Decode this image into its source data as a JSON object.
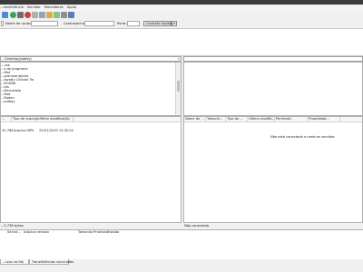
{
  "menu": [
    "...ransferência",
    "Servidor",
    "Marcadores",
    "Ajuda"
  ],
  "toolbar": {
    "icons": [
      "connect-icon",
      "refresh-icon",
      "process-queue-icon",
      "cancel-icon",
      "disconnect-icon",
      "reconnect-icon",
      "filter-icon",
      "compare-icon",
      "sync-browse-icon",
      "search-icon"
    ]
  },
  "quickconnect": {
    "user_label": "Nome de usuário:",
    "password_label": "Contrasenha:",
    "port_label": "Porta:",
    "button_label": "Conexão rápida"
  },
  "local": {
    "path": "...Desktop\\Jadeby\\",
    "tree": [
      "...use",
      "...s de programa",
      "...ftist",
      "...gramaoriginals",
      "...ewotty Cellular Tw",
      "...ROGRA",
      "...tes",
      "...Mercadola",
      "...Red",
      "...Rodan",
      "...Jadeby"
    ],
    "columns": [
      "...",
      "Tipo de arquivo",
      "Última modificação"
    ],
    "files": [
      {
        "size": "32,784",
        "type": "Arquivo MP4",
        "modified": "22/01/2019 13:32:52"
      }
    ],
    "status": "...2,738 bytes"
  },
  "remote": {
    "path": "",
    "columns": [
      "Nome de ...",
      "Tamanh...",
      "Tipo do ...",
      "Última modific...",
      "Permissõ...",
      "Propriedad..."
    ],
    "empty_message": "Não está conectado a nenhum servidor",
    "status": "Não conectado."
  },
  "queue": {
    "columns": [
      "Servid...",
      "Arquivo remoto",
      "Tamanho",
      "Prioridad",
      "Estado"
    ]
  },
  "tabs": [
    "...ivos na fila",
    "Transferências concluídas"
  ]
}
